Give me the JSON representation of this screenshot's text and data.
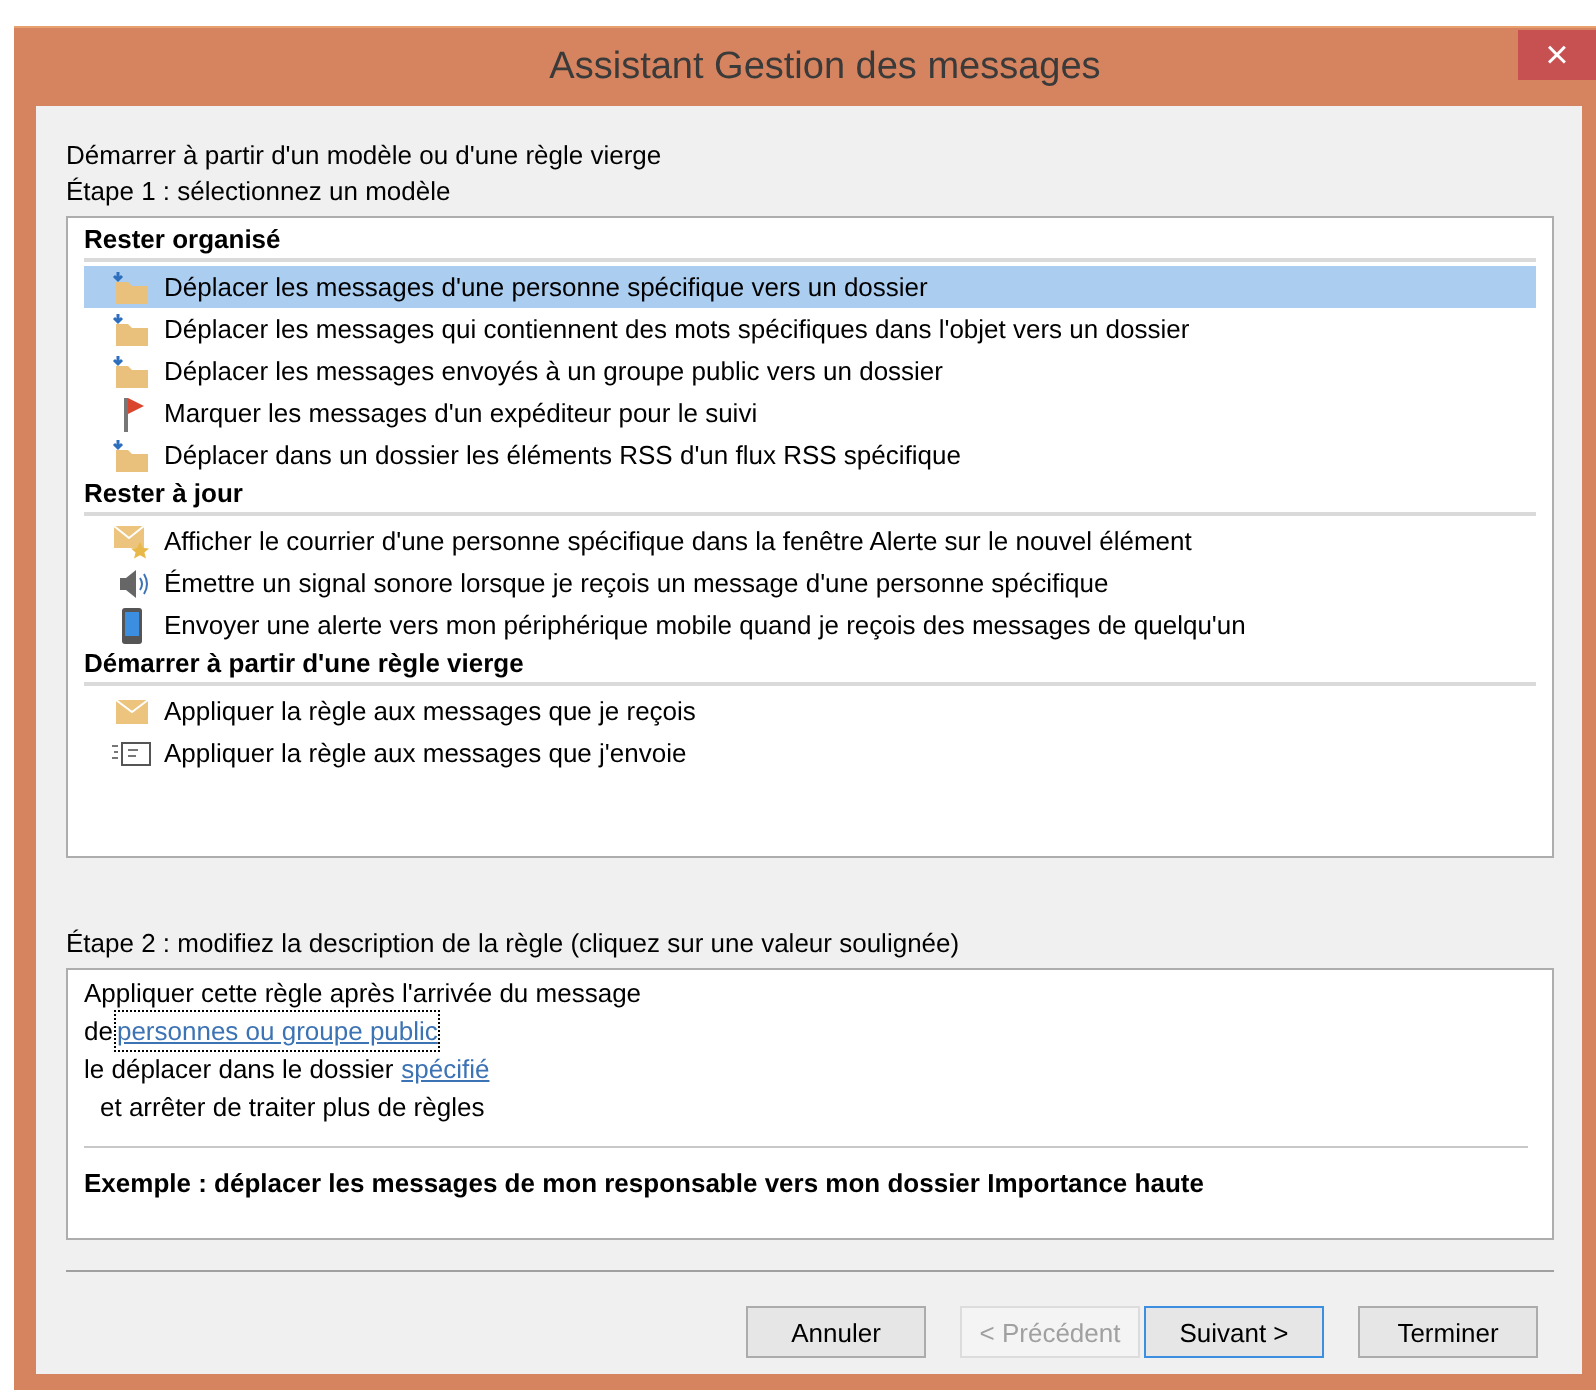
{
  "window": {
    "title": "Assistant Gestion des messages",
    "close": "×"
  },
  "intro": "Démarrer à partir d'un modèle ou d'une règle vierge",
  "step1": "Étape 1 : sélectionnez un modèle",
  "groups": [
    {
      "title": "Rester organisé",
      "items": [
        {
          "label": "Déplacer les messages d'une personne spécifique vers un dossier",
          "kind": "move",
          "selected": true
        },
        {
          "label": "Déplacer les messages qui contiennent des mots spécifiques dans l'objet vers un dossier",
          "kind": "move",
          "selected": false
        },
        {
          "label": "Déplacer les messages envoyés à un groupe public vers un dossier",
          "kind": "move",
          "selected": false
        },
        {
          "label": "Marquer les messages d'un expéditeur pour le suivi",
          "kind": "flag",
          "selected": false
        },
        {
          "label": "Déplacer dans un dossier les éléments RSS d'un flux RSS spécifique",
          "kind": "move",
          "selected": false
        }
      ]
    },
    {
      "title": "Rester à jour",
      "items": [
        {
          "label": "Afficher le courrier d'une personne spécifique dans la fenêtre Alerte sur le nouvel élément",
          "kind": "alert",
          "selected": false
        },
        {
          "label": "Émettre un signal sonore lorsque je reçois un message d'une personne spécifique",
          "kind": "sound",
          "selected": false
        },
        {
          "label": "Envoyer une alerte vers mon périphérique mobile quand je reçois des messages de quelqu'un",
          "kind": "mobile",
          "selected": false
        }
      ]
    },
    {
      "title": "Démarrer à partir d'une règle vierge",
      "items": [
        {
          "label": "Appliquer la règle aux messages que je reçois",
          "kind": "mail",
          "selected": false
        },
        {
          "label": "Appliquer la règle aux messages que j'envoie",
          "kind": "send",
          "selected": false
        }
      ]
    }
  ],
  "step2": "Étape 2 : modifiez la description de la règle (cliquez sur une valeur soulignée)",
  "description": [
    {
      "indented": false,
      "parts": [
        {
          "kind": "text",
          "text": "Appliquer cette règle après l'arrivée du message"
        }
      ]
    },
    {
      "indented": false,
      "parts": [
        {
          "kind": "text",
          "text": "de"
        },
        {
          "kind": "link",
          "text": "personnes ou groupe public",
          "focused": true
        }
      ]
    },
    {
      "indented": false,
      "parts": [
        {
          "kind": "text",
          "text": "le déplacer dans le dossier"
        },
        {
          "kind": "link",
          "text": "spécifié",
          "focused": false
        }
      ]
    },
    {
      "indented": true,
      "parts": [
        {
          "kind": "text",
          "text": "et arrêter de traiter plus de règles"
        }
      ]
    }
  ],
  "example": "Exemple : déplacer les messages de mon responsable vers mon dossier Importance haute",
  "buttons": [
    {
      "label": "Annuler",
      "disabled": false,
      "default": false
    },
    {
      "label": "< Précédent",
      "disabled": true,
      "default": false
    },
    {
      "label": "Suivant >",
      "disabled": false,
      "default": true
    },
    {
      "label": "Terminer",
      "disabled": false,
      "default": false
    }
  ]
}
